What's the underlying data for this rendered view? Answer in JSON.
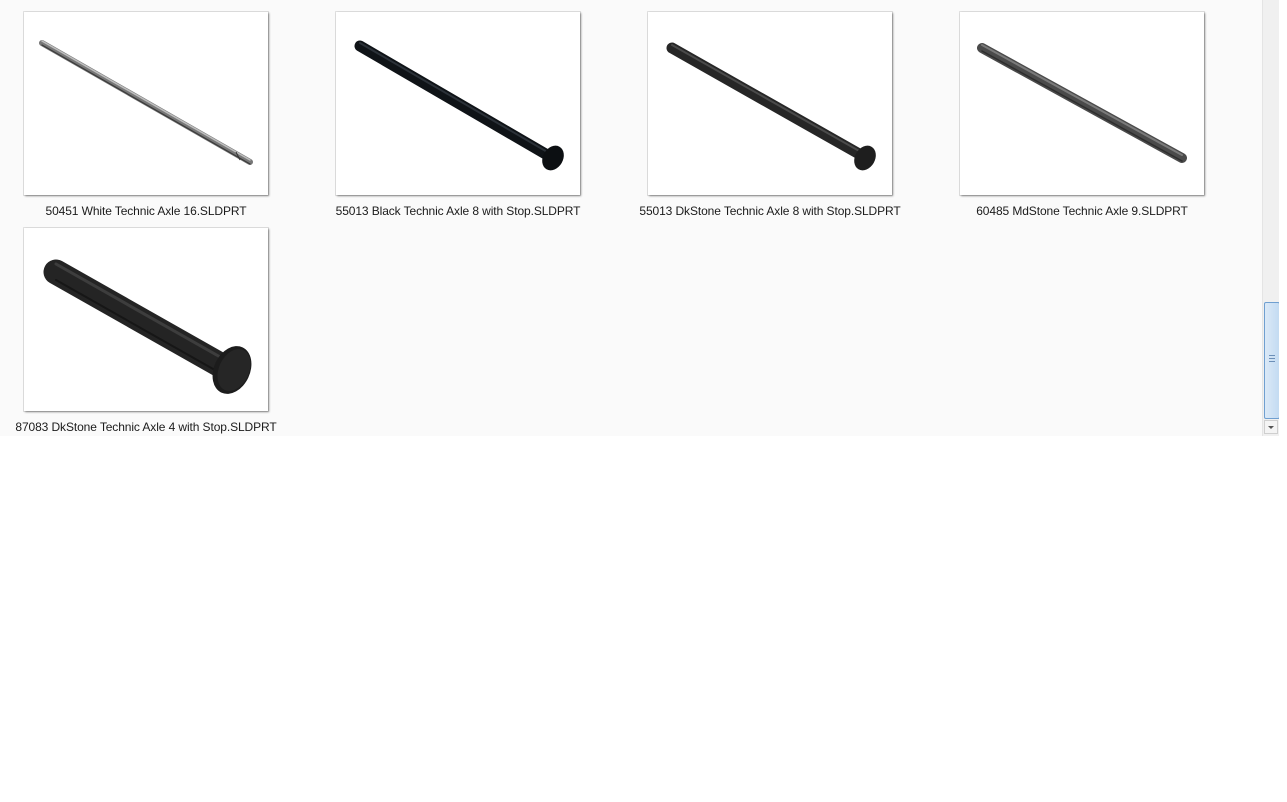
{
  "files": [
    {
      "name": "50451 White Technic Axle 16.SLDPRT",
      "thumb_color": "#6d6d6d"
    },
    {
      "name": "55013 Black Technic Axle 8 with Stop.SLDPRT",
      "thumb_color": "#0f1317"
    },
    {
      "name": "55013 DkStone Technic Axle 8 with Stop.SLDPRT",
      "thumb_color": "#262626"
    },
    {
      "name": "60485 MdStone Technic Axle 9.SLDPRT",
      "thumb_color": "#4a4a4a"
    },
    {
      "name": "87083 DkStone Technic Axle 4 with Stop.SLDPRT",
      "thumb_color": "#242424"
    }
  ],
  "scrollbar": {
    "position": 0.9
  }
}
